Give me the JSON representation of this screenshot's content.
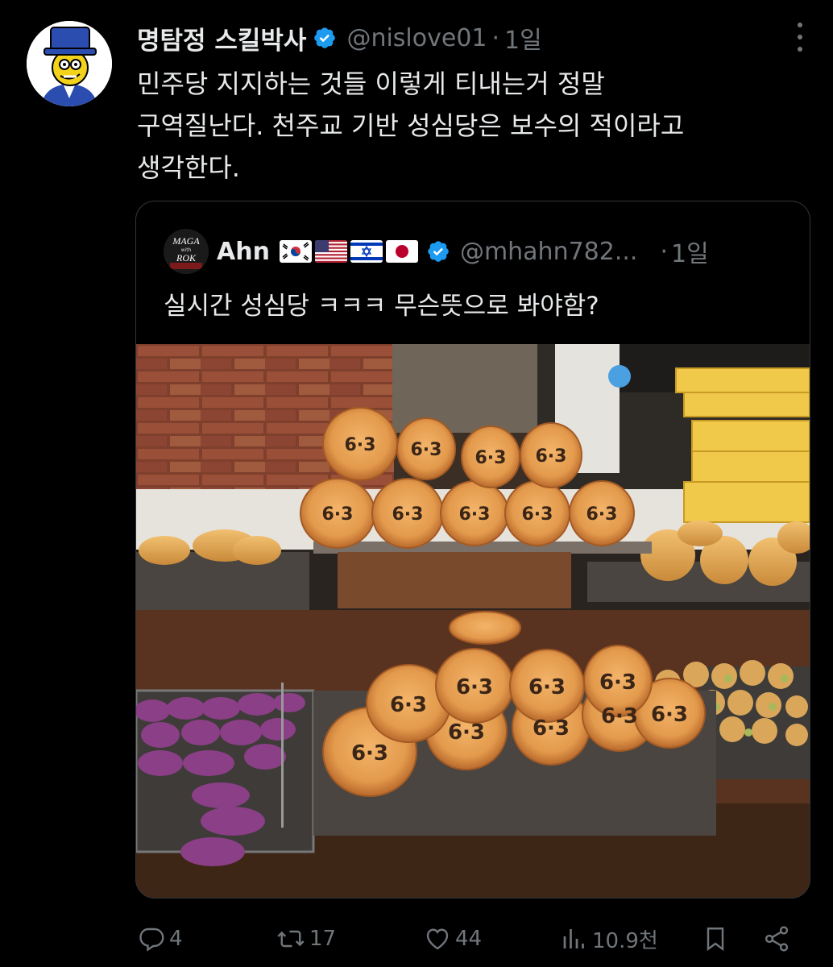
{
  "tweet": {
    "author_name": "명탐정 스킬박사",
    "handle": "@nislove01",
    "separator": "·",
    "time": "1일",
    "text": "민주당 지지하는 것들 이렇게 티내는거 정말\n구역질난다. 천주교 기반 성심당은 보수의 적이라고\n생각한다."
  },
  "quote": {
    "avatar_text_top": "MAGA",
    "avatar_text_mid": "with",
    "avatar_text_bot": "ROK",
    "author_name": "Ahn",
    "flags": [
      "south-korea-flag",
      "usa-flag",
      "israel-flag",
      "japan-flag"
    ],
    "handle": "@mhahn782...",
    "separator": "·",
    "time": "1일",
    "text": "실시간 성심당 ㅋㅋㅋ 무슨뜻으로 봐야함?",
    "photo": {
      "bread_stamp": "6·3"
    }
  },
  "actions": {
    "reply_count": "4",
    "retweet_count": "17",
    "like_count": "44",
    "views_count": "10.9천"
  },
  "colors": {
    "background": "#000000",
    "text": "#e7e9ea",
    "muted": "#71767b",
    "verified": "#1d9bf0",
    "border": "#333639"
  },
  "icons": [
    "more-icon",
    "verified-icon",
    "reply-icon",
    "retweet-icon",
    "like-icon",
    "views-icon",
    "bookmark-icon",
    "share-icon"
  ]
}
